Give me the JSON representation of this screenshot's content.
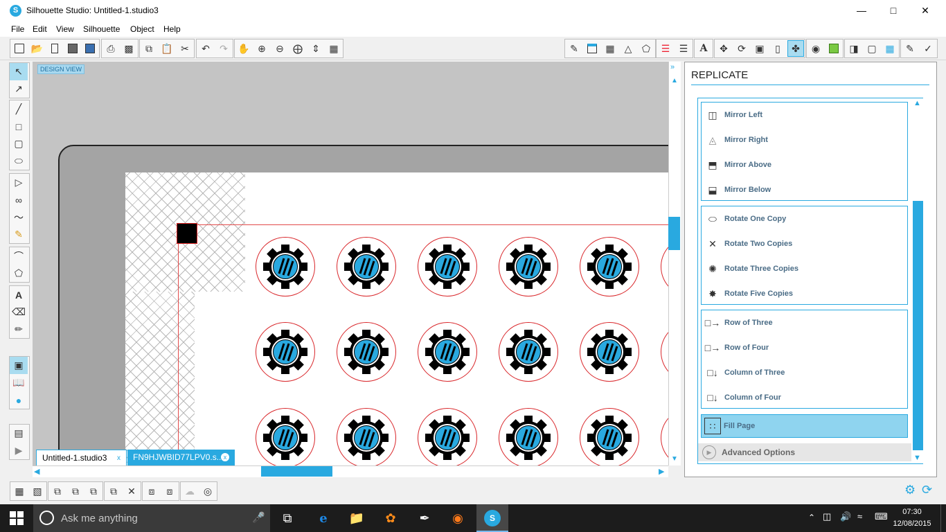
{
  "window": {
    "title": "Silhouette Studio: Untitled-1.studio3",
    "app_icon_glyph": "S"
  },
  "menu": [
    "File",
    "Edit",
    "View",
    "Silhouette",
    "Object",
    "Help"
  ],
  "canvas": {
    "view_label": "DESIGN VIEW"
  },
  "tabs": [
    {
      "label": "Untitled-1.studio3",
      "close": "x"
    },
    {
      "label": "FN9HJWBID77LPV0.s...",
      "close": "x"
    }
  ],
  "panel": {
    "title": "REPLICATE",
    "groups": [
      {
        "items": [
          {
            "label": "Mirror Left",
            "icon": "mirror-left-icon"
          },
          {
            "label": "Mirror Right",
            "icon": "mirror-right-icon"
          },
          {
            "label": "Mirror Above",
            "icon": "mirror-above-icon"
          },
          {
            "label": "Mirror Below",
            "icon": "mirror-below-icon"
          }
        ]
      },
      {
        "items": [
          {
            "label": "Rotate One Copy",
            "icon": "rotate-one-icon"
          },
          {
            "label": "Rotate Two Copies",
            "icon": "rotate-two-icon"
          },
          {
            "label": "Rotate Three Copies",
            "icon": "rotate-three-icon"
          },
          {
            "label": "Rotate Five Copies",
            "icon": "rotate-five-icon"
          }
        ]
      },
      {
        "items": [
          {
            "label": "Row of Three",
            "icon": "row-three-icon"
          },
          {
            "label": "Row of Four",
            "icon": "row-four-icon"
          },
          {
            "label": "Column of Three",
            "icon": "column-three-icon"
          },
          {
            "label": "Column of Four",
            "icon": "column-four-icon"
          }
        ]
      }
    ],
    "fill_page": "Fill Page",
    "advanced": "Advanced Options"
  },
  "taskbar": {
    "search_placeholder": "Ask me anything",
    "time": "07:30",
    "date": "12/08/2015"
  },
  "colors": {
    "accent": "#29a9e0",
    "cut_line": "#d9262a",
    "mat": "#a4a4a4"
  }
}
